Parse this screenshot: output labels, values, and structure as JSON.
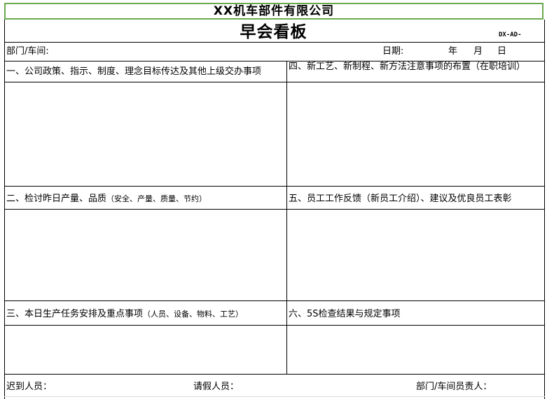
{
  "company": "XX机车部件有限公司",
  "title": "早会看板",
  "form_code": "DX-AD-",
  "header": {
    "department_label": "部门/车间:",
    "date_label": "日期:",
    "year": "年",
    "month": "月",
    "day": "日"
  },
  "sections": {
    "s1": {
      "title": "一、公司政策、指示、制度、理念目标传达及其他上级交办事项"
    },
    "s4": {
      "title": "四、新工艺、新制程、新方法注意事项的布置（在职培训）"
    },
    "s2": {
      "title_main": "二、检讨昨日产量、品质",
      "title_note": "（安全、产量、质量、节约）"
    },
    "s5": {
      "title": "五、员工工作反馈（新员工介绍）、建议及优良员工表彰"
    },
    "s3": {
      "title_main": "三、本日生产任务安排及重点事项",
      "title_note": "（人员、设备、物料、工艺）"
    },
    "s6": {
      "title": "六、5S检查结果与规定事项"
    }
  },
  "footer": {
    "late_label": "迟到人员：",
    "leave_label": "请假人员：",
    "responsible_label": "部门/车间员责人："
  }
}
